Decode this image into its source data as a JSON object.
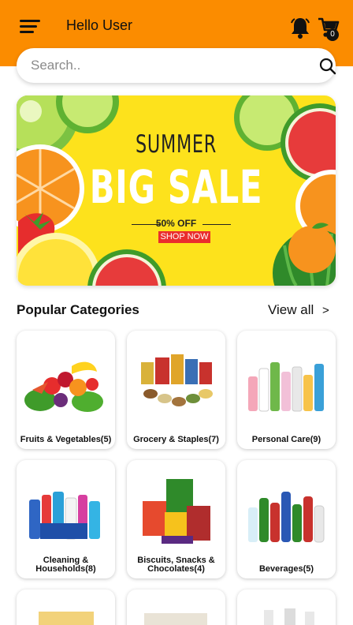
{
  "header": {
    "greeting": "Hello User",
    "cart_count": "0",
    "icons": {
      "menu": "hamburger-icon",
      "notifications": "bell-icon",
      "cart": "cart-icon"
    },
    "colors": {
      "background": "#fb8c00"
    }
  },
  "search": {
    "placeholder": "Search..",
    "icon": "search-icon"
  },
  "banner": {
    "line1": "SUMMER",
    "line2": "BIG SALE",
    "line3": "50% OFF",
    "cta": "SHOP NOW",
    "colors": {
      "background": "#fde21c",
      "cta": "#ea2d2d"
    }
  },
  "categories": {
    "title": "Popular Categories",
    "view_all": "View all",
    "view_all_icon": "chevron-right-icon",
    "items": [
      {
        "label": "Fruits & Vegetables(5)"
      },
      {
        "label": "Grocery & Staples(7)"
      },
      {
        "label": "Personal Care(9)"
      },
      {
        "label": "Cleaning & Households(8)"
      },
      {
        "label": "Biscuits, Snacks & Chocolates(4)"
      },
      {
        "label": "Beverages(5)"
      }
    ]
  }
}
